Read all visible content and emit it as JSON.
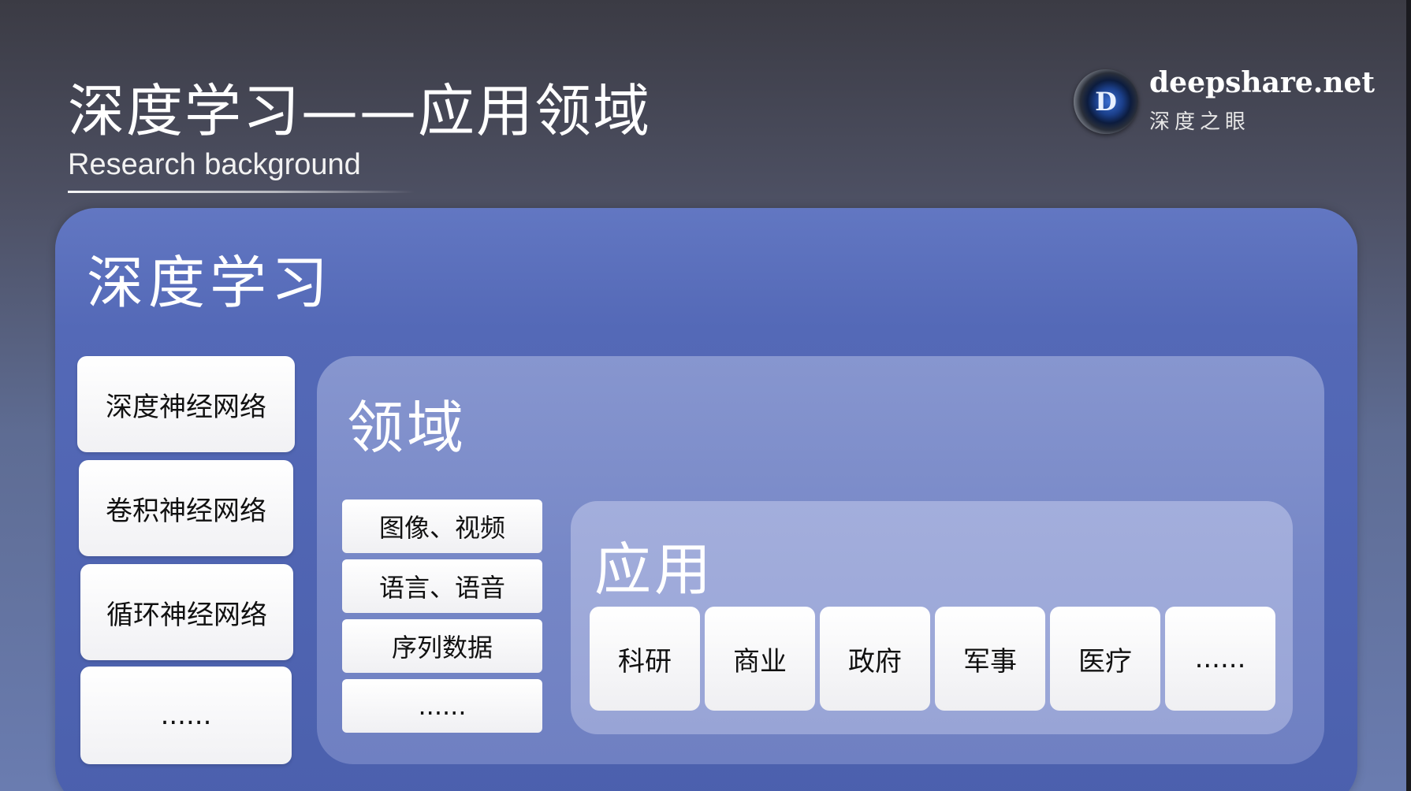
{
  "header": {
    "title": "深度学习——应用领域",
    "subtitle": "Research background"
  },
  "brand": {
    "logo_letter": "D",
    "domain": "deepshare.net",
    "name_cn": "深度之眼"
  },
  "deep_learning": {
    "title": "深度学习",
    "networks": [
      "深度神经网络",
      "卷积神经网络",
      "循环神经网络",
      "......"
    ]
  },
  "domains": {
    "title": "领域",
    "items": [
      "图像、视频",
      "语言、语音",
      "序列数据",
      "......"
    ]
  },
  "applications": {
    "title": "应用",
    "items": [
      "科研",
      "商业",
      "政府",
      "军事",
      "医疗",
      "......"
    ]
  },
  "colors": {
    "background_top": "#3b3b44",
    "background_bottom": "#6a7cb0",
    "deep_learning_panel": "#5469b7",
    "domain_panel": "#7586c6",
    "application_panel": "#98a4d6",
    "card": "#ffffff"
  },
  "icons": {
    "logo": "deepshare-eye-logo-icon"
  }
}
